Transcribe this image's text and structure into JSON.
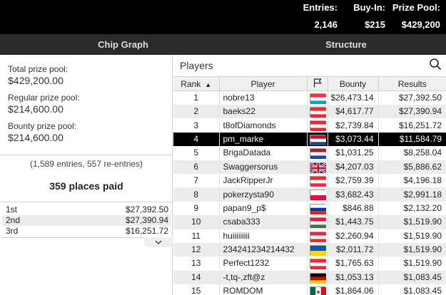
{
  "header": {
    "entries_label": "Entries:",
    "entries_value": "2,146",
    "buyin_label": "Buy-In:",
    "buyin_value": "$215",
    "prize_label": "Prize Pool:",
    "prize_value": "$429,200"
  },
  "tabs": [
    {
      "label": "Chip Graph"
    },
    {
      "label": "Structure"
    }
  ],
  "summary": {
    "total_label": "Total prize pool:",
    "total_value": "$429,200.00",
    "regular_label": "Regular prize pool:",
    "regular_value": "$214,600.00",
    "bounty_label": "Bounty prize pool:",
    "bounty_value": "$214,600.00",
    "entries_note": "(1,589 entries, 557 re-entries)",
    "places_paid": "359 places paid"
  },
  "payouts": [
    {
      "place": "1st",
      "amount": "$27,392.50"
    },
    {
      "place": "2nd",
      "amount": "$27,390.94"
    },
    {
      "place": "3rd",
      "amount": "$16,251.72"
    }
  ],
  "players_panel": {
    "title": "Players",
    "columns": {
      "rank": "Rank",
      "player": "Player",
      "bounty": "Bounty",
      "results": "Results"
    }
  },
  "colors": {
    "highlight_row": "#000000",
    "alt_row": "#ececec"
  },
  "players": [
    {
      "rank": "1",
      "name": "nobre13",
      "flag": "luxembourg-flag",
      "bounty": "$26,473.14",
      "results": "$27,392.50"
    },
    {
      "rank": "2",
      "name": "baeks22",
      "flag": "austria-flag",
      "bounty": "$4,617.77",
      "results": "$27,390.94"
    },
    {
      "rank": "3",
      "name": "t8ofDiamonds",
      "flag": "austria-flag",
      "bounty": "$2,739.84",
      "results": "$16,251.72"
    },
    {
      "rank": "4",
      "name": "pm_marke",
      "flag": "netherlands-flag",
      "bounty": "$3,073.44",
      "results": "$11,584.79"
    },
    {
      "rank": "5",
      "name": "BrigaDatada",
      "flag": "netherlands-flag",
      "bounty": "$1,031.25",
      "results": "$8,258.04"
    },
    {
      "rank": "6",
      "name": "Swaggersorus",
      "flag": "uk-flag",
      "bounty": "$4,207.03",
      "results": "$5,886.62"
    },
    {
      "rank": "7",
      "name": "JackRipperJr",
      "flag": "austria-flag",
      "bounty": "$2,759.39",
      "results": "$4,196.18"
    },
    {
      "rank": "8",
      "name": "pokerzysta90",
      "flag": "poland-flag",
      "bounty": "$3,682.43",
      "results": "$2,991.18"
    },
    {
      "rank": "9",
      "name": "papan9_p$",
      "flag": "russia-flag",
      "bounty": "$846.88",
      "results": "$2,132.20"
    },
    {
      "rank": "10",
      "name": "csaba333",
      "flag": "hungary-flag",
      "bounty": "$1,443.75",
      "results": "$1,519.90"
    },
    {
      "rank": "11",
      "name": "huiiiiiiiii",
      "flag": "austria-flag",
      "bounty": "$2,260.94",
      "results": "$1,519.90"
    },
    {
      "rank": "12",
      "name": "234241234214432",
      "flag": "ukraine-flag",
      "bounty": "$2,011.72",
      "results": "$1,519.90"
    },
    {
      "rank": "13",
      "name": "Perfect1232",
      "flag": "austria-flag",
      "bounty": "$1,765.63",
      "results": "$1,519.90"
    },
    {
      "rank": "14",
      "name": "-t,tq-,zft@z",
      "flag": "germany-flag",
      "bounty": "$1,053.13",
      "results": "$1,083.45"
    },
    {
      "rank": "15",
      "name": "ROMDOM",
      "flag": "mexico-flag",
      "bounty": "$1,864.06",
      "results": "$1,083.45"
    }
  ]
}
